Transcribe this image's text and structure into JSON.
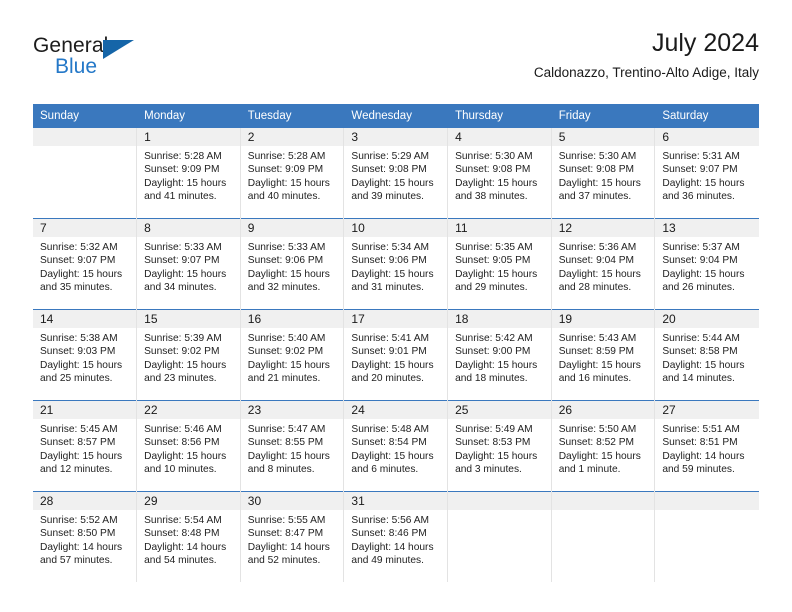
{
  "brand": {
    "name_part1": "General",
    "name_part2": "Blue",
    "triangle_color": "#1565a8",
    "accent_color": "#2478c8"
  },
  "header": {
    "month_title": "July 2024",
    "location": "Caldonazzo, Trentino-Alto Adige, Italy"
  },
  "theme": {
    "header_blue": "#3a78be",
    "daynum_band": "#f0f0f0",
    "grid_line": "#e3e3e3",
    "text": "#1a1a1a"
  },
  "weekdays": [
    "Sunday",
    "Monday",
    "Tuesday",
    "Wednesday",
    "Thursday",
    "Friday",
    "Saturday"
  ],
  "weeks": [
    [
      {
        "day": "",
        "empty": true,
        "sunrise": "",
        "sunset": "",
        "daylight_line1": "",
        "daylight_line2": ""
      },
      {
        "day": "1",
        "sunrise": "Sunrise: 5:28 AM",
        "sunset": "Sunset: 9:09 PM",
        "daylight_line1": "Daylight: 15 hours",
        "daylight_line2": "and 41 minutes."
      },
      {
        "day": "2",
        "sunrise": "Sunrise: 5:28 AM",
        "sunset": "Sunset: 9:09 PM",
        "daylight_line1": "Daylight: 15 hours",
        "daylight_line2": "and 40 minutes."
      },
      {
        "day": "3",
        "sunrise": "Sunrise: 5:29 AM",
        "sunset": "Sunset: 9:08 PM",
        "daylight_line1": "Daylight: 15 hours",
        "daylight_line2": "and 39 minutes."
      },
      {
        "day": "4",
        "sunrise": "Sunrise: 5:30 AM",
        "sunset": "Sunset: 9:08 PM",
        "daylight_line1": "Daylight: 15 hours",
        "daylight_line2": "and 38 minutes."
      },
      {
        "day": "5",
        "sunrise": "Sunrise: 5:30 AM",
        "sunset": "Sunset: 9:08 PM",
        "daylight_line1": "Daylight: 15 hours",
        "daylight_line2": "and 37 minutes."
      },
      {
        "day": "6",
        "sunrise": "Sunrise: 5:31 AM",
        "sunset": "Sunset: 9:07 PM",
        "daylight_line1": "Daylight: 15 hours",
        "daylight_line2": "and 36 minutes."
      }
    ],
    [
      {
        "day": "7",
        "sunrise": "Sunrise: 5:32 AM",
        "sunset": "Sunset: 9:07 PM",
        "daylight_line1": "Daylight: 15 hours",
        "daylight_line2": "and 35 minutes."
      },
      {
        "day": "8",
        "sunrise": "Sunrise: 5:33 AM",
        "sunset": "Sunset: 9:07 PM",
        "daylight_line1": "Daylight: 15 hours",
        "daylight_line2": "and 34 minutes."
      },
      {
        "day": "9",
        "sunrise": "Sunrise: 5:33 AM",
        "sunset": "Sunset: 9:06 PM",
        "daylight_line1": "Daylight: 15 hours",
        "daylight_line2": "and 32 minutes."
      },
      {
        "day": "10",
        "sunrise": "Sunrise: 5:34 AM",
        "sunset": "Sunset: 9:06 PM",
        "daylight_line1": "Daylight: 15 hours",
        "daylight_line2": "and 31 minutes."
      },
      {
        "day": "11",
        "sunrise": "Sunrise: 5:35 AM",
        "sunset": "Sunset: 9:05 PM",
        "daylight_line1": "Daylight: 15 hours",
        "daylight_line2": "and 29 minutes."
      },
      {
        "day": "12",
        "sunrise": "Sunrise: 5:36 AM",
        "sunset": "Sunset: 9:04 PM",
        "daylight_line1": "Daylight: 15 hours",
        "daylight_line2": "and 28 minutes."
      },
      {
        "day": "13",
        "sunrise": "Sunrise: 5:37 AM",
        "sunset": "Sunset: 9:04 PM",
        "daylight_line1": "Daylight: 15 hours",
        "daylight_line2": "and 26 minutes."
      }
    ],
    [
      {
        "day": "14",
        "sunrise": "Sunrise: 5:38 AM",
        "sunset": "Sunset: 9:03 PM",
        "daylight_line1": "Daylight: 15 hours",
        "daylight_line2": "and 25 minutes."
      },
      {
        "day": "15",
        "sunrise": "Sunrise: 5:39 AM",
        "sunset": "Sunset: 9:02 PM",
        "daylight_line1": "Daylight: 15 hours",
        "daylight_line2": "and 23 minutes."
      },
      {
        "day": "16",
        "sunrise": "Sunrise: 5:40 AM",
        "sunset": "Sunset: 9:02 PM",
        "daylight_line1": "Daylight: 15 hours",
        "daylight_line2": "and 21 minutes."
      },
      {
        "day": "17",
        "sunrise": "Sunrise: 5:41 AM",
        "sunset": "Sunset: 9:01 PM",
        "daylight_line1": "Daylight: 15 hours",
        "daylight_line2": "and 20 minutes."
      },
      {
        "day": "18",
        "sunrise": "Sunrise: 5:42 AM",
        "sunset": "Sunset: 9:00 PM",
        "daylight_line1": "Daylight: 15 hours",
        "daylight_line2": "and 18 minutes."
      },
      {
        "day": "19",
        "sunrise": "Sunrise: 5:43 AM",
        "sunset": "Sunset: 8:59 PM",
        "daylight_line1": "Daylight: 15 hours",
        "daylight_line2": "and 16 minutes."
      },
      {
        "day": "20",
        "sunrise": "Sunrise: 5:44 AM",
        "sunset": "Sunset: 8:58 PM",
        "daylight_line1": "Daylight: 15 hours",
        "daylight_line2": "and 14 minutes."
      }
    ],
    [
      {
        "day": "21",
        "sunrise": "Sunrise: 5:45 AM",
        "sunset": "Sunset: 8:57 PM",
        "daylight_line1": "Daylight: 15 hours",
        "daylight_line2": "and 12 minutes."
      },
      {
        "day": "22",
        "sunrise": "Sunrise: 5:46 AM",
        "sunset": "Sunset: 8:56 PM",
        "daylight_line1": "Daylight: 15 hours",
        "daylight_line2": "and 10 minutes."
      },
      {
        "day": "23",
        "sunrise": "Sunrise: 5:47 AM",
        "sunset": "Sunset: 8:55 PM",
        "daylight_line1": "Daylight: 15 hours",
        "daylight_line2": "and 8 minutes."
      },
      {
        "day": "24",
        "sunrise": "Sunrise: 5:48 AM",
        "sunset": "Sunset: 8:54 PM",
        "daylight_line1": "Daylight: 15 hours",
        "daylight_line2": "and 6 minutes."
      },
      {
        "day": "25",
        "sunrise": "Sunrise: 5:49 AM",
        "sunset": "Sunset: 8:53 PM",
        "daylight_line1": "Daylight: 15 hours",
        "daylight_line2": "and 3 minutes."
      },
      {
        "day": "26",
        "sunrise": "Sunrise: 5:50 AM",
        "sunset": "Sunset: 8:52 PM",
        "daylight_line1": "Daylight: 15 hours",
        "daylight_line2": "and 1 minute."
      },
      {
        "day": "27",
        "sunrise": "Sunrise: 5:51 AM",
        "sunset": "Sunset: 8:51 PM",
        "daylight_line1": "Daylight: 14 hours",
        "daylight_line2": "and 59 minutes."
      }
    ],
    [
      {
        "day": "28",
        "sunrise": "Sunrise: 5:52 AM",
        "sunset": "Sunset: 8:50 PM",
        "daylight_line1": "Daylight: 14 hours",
        "daylight_line2": "and 57 minutes."
      },
      {
        "day": "29",
        "sunrise": "Sunrise: 5:54 AM",
        "sunset": "Sunset: 8:48 PM",
        "daylight_line1": "Daylight: 14 hours",
        "daylight_line2": "and 54 minutes."
      },
      {
        "day": "30",
        "sunrise": "Sunrise: 5:55 AM",
        "sunset": "Sunset: 8:47 PM",
        "daylight_line1": "Daylight: 14 hours",
        "daylight_line2": "and 52 minutes."
      },
      {
        "day": "31",
        "sunrise": "Sunrise: 5:56 AM",
        "sunset": "Sunset: 8:46 PM",
        "daylight_line1": "Daylight: 14 hours",
        "daylight_line2": "and 49 minutes."
      },
      {
        "day": "",
        "empty": true,
        "sunrise": "",
        "sunset": "",
        "daylight_line1": "",
        "daylight_line2": ""
      },
      {
        "day": "",
        "empty": true,
        "sunrise": "",
        "sunset": "",
        "daylight_line1": "",
        "daylight_line2": ""
      },
      {
        "day": "",
        "empty": true,
        "sunrise": "",
        "sunset": "",
        "daylight_line1": "",
        "daylight_line2": ""
      }
    ]
  ]
}
